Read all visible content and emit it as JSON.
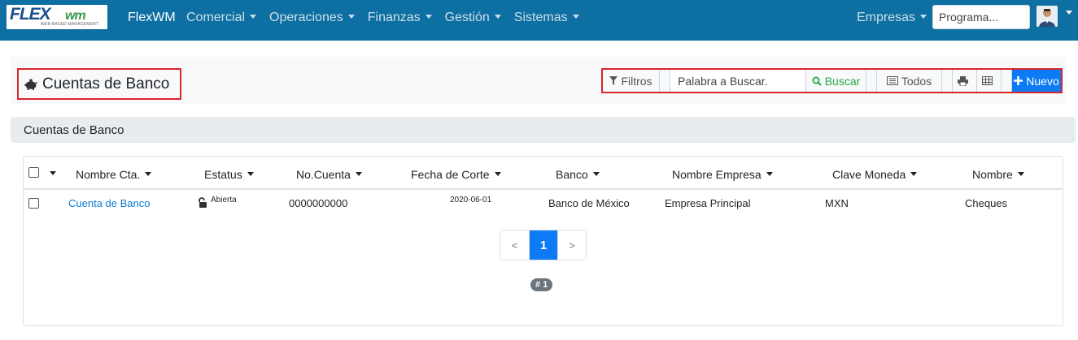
{
  "navbar": {
    "logo": {
      "text_main": "FLEX",
      "text_wm": "wm",
      "text_sub": "WEB-BASED MANAGEMENT"
    },
    "brand": "FlexWM",
    "menu": [
      {
        "label": "Comercial"
      },
      {
        "label": "Operaciones"
      },
      {
        "label": "Finanzas"
      },
      {
        "label": "Gestión"
      },
      {
        "label": "Sistemas"
      }
    ],
    "empresas_label": "Empresas",
    "program_placeholder": "Programa...",
    "accent_color": "#0e6fa2"
  },
  "header": {
    "title": "Cuentas de Banco",
    "title_icon": "piggy-bank-icon",
    "filters_label": "Filtros",
    "search_placeholder": "Palabra a Buscar.",
    "search_button_label": "Buscar",
    "all_button_label": "Todos",
    "print_icon": "print-icon",
    "grid_icon": "table-icon",
    "new_button_label": "Nuevo",
    "primary_color": "#0d7bf5",
    "highlight_color": "#d9242b"
  },
  "section": {
    "title": "Cuentas de Banco"
  },
  "table": {
    "columns": [
      {
        "label": "Nombre Cta."
      },
      {
        "label": "Estatus"
      },
      {
        "label": "No.Cuenta"
      },
      {
        "label": "Fecha de Corte"
      },
      {
        "label": "Banco"
      },
      {
        "label": "Nombre Empresa"
      },
      {
        "label": "Clave Moneda"
      },
      {
        "label": "Nombre"
      }
    ],
    "rows": [
      {
        "name": "Cuenta de Banco",
        "status": "Abierta",
        "status_icon": "unlock-icon",
        "account_no": "0000000000",
        "cut_date": "2020-06-01",
        "bank": "Banco de México",
        "company": "Empresa Principal",
        "currency": "MXN",
        "type_name": "Cheques"
      }
    ]
  },
  "pagination": {
    "prev": "<",
    "current": "1",
    "next": ">",
    "count_badge": "# 1"
  }
}
